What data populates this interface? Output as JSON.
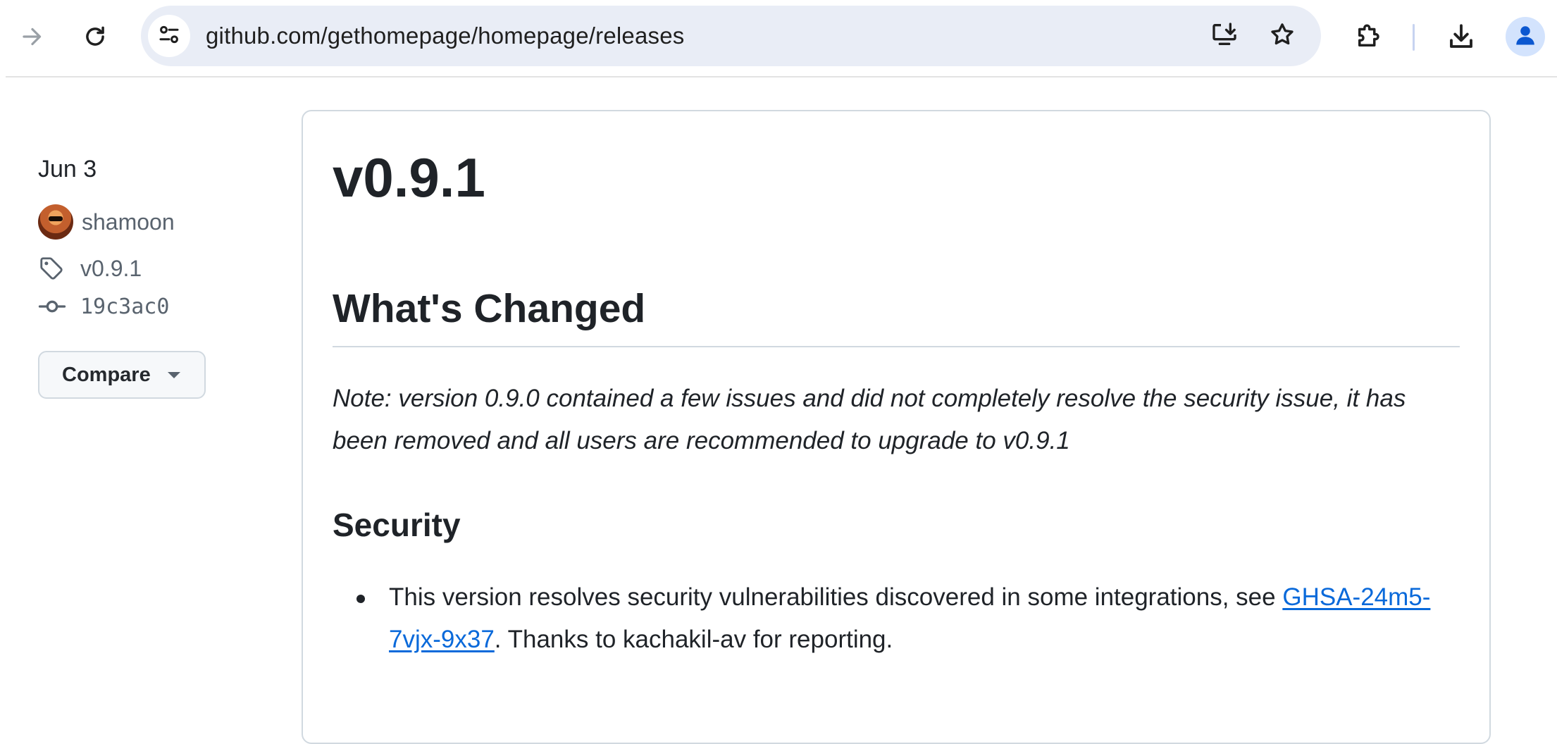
{
  "browser": {
    "url": "github.com/gethomepage/homepage/releases",
    "icons": {
      "forward": "arrow-right-icon",
      "reload": "reload-icon",
      "site_info": "tune-icon",
      "install_app": "install-app-icon",
      "bookmark": "star-icon",
      "extensions": "puzzle-icon",
      "downloads": "download-icon",
      "profile": "person-icon"
    }
  },
  "release": {
    "date": "Jun 3",
    "author": "shamoon",
    "tag": "v0.9.1",
    "commit": "19c3ac0",
    "compare_label": "Compare",
    "title": "v0.9.1",
    "whats_changed_heading": "What's Changed",
    "note": "Note: version 0.9.0 contained a few issues and did not completely resolve the security issue, it has been removed and all users are recommended to upgrade to v0.9.1",
    "security_heading": "Security",
    "security_item": {
      "prefix": "This version resolves security vulnerabilities discovered in some integrations, see",
      "link": "GHSA-24m5-7vjx-9x37",
      "suffix": ". Thanks to kachakil-av for reporting."
    }
  },
  "colors": {
    "link": "#0969da",
    "border": "#d1d9e0",
    "omnibox": "#e9edf6",
    "text": "#1f2328",
    "muted": "#59636e"
  }
}
